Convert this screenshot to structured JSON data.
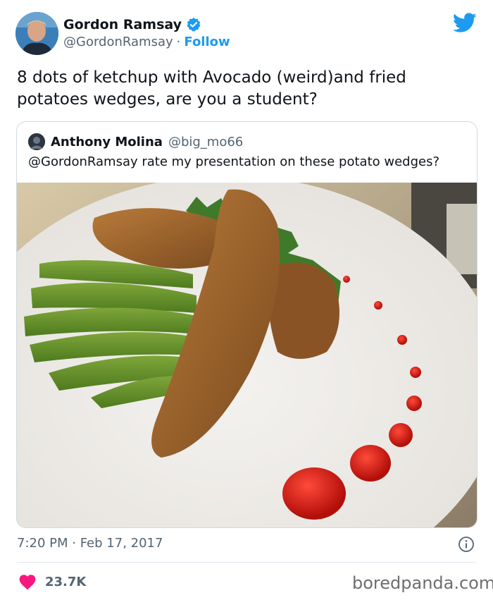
{
  "tweet": {
    "author_name": "Gordon Ramsay",
    "author_handle": "@GordonRamsay",
    "separator": "·",
    "follow_label": "Follow",
    "text_line1": "8 dots of ketchup with Avocado (weird)and fried",
    "text_line2": "potatoes wedges, are you a student?",
    "timestamp": "7:20 PM · Feb 17, 2017",
    "likes": "23.7K"
  },
  "quoted_tweet": {
    "author_name": "Anthony Molina",
    "author_handle": "@big_mo66",
    "text": "@GordonRamsay rate my presentation on these potato wedges?"
  },
  "watermark": "boredpanda.com",
  "icons": {
    "brand": "twitter-bird-icon",
    "verified": "verified-badge-icon",
    "info": "info-icon",
    "like": "heart-icon"
  },
  "colors": {
    "accent": "#1d9bf0",
    "like": "#f91880",
    "muted": "#536471",
    "border": "#cfd9de"
  }
}
